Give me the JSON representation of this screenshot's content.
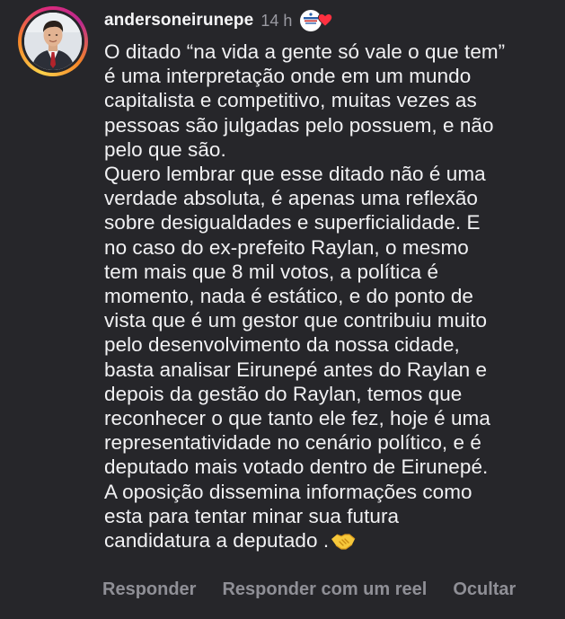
{
  "comment": {
    "username": "andersoneirunepe",
    "timestamp": "14 h",
    "text_lines": [
      "O ditado “na vida a gente só vale o que tem”",
      "é uma interpretação onde em um mundo",
      "capitalista e competitivo, muitas vezes as",
      "pessoas são julgadas pelo possuem, e não",
      "pelo que são.",
      "Quero lembrar que esse ditado não é uma",
      "verdade absoluta, é apenas uma reflexão",
      "sobre desigualdades e superficialidade. E",
      "no caso do ex-prefeito Raylan, o mesmo",
      "tem mais que 8 mil votos, a política é",
      "momento, nada é estático, e do ponto de",
      "vista que é um gestor que contribuiu muito",
      "pelo desenvolvimento da nossa cidade,",
      "basta analisar Eirunepé antes do Raylan e",
      "depois da gestão do Raylan, temos que",
      "reconhecer o que tanto ele fez, hoje é uma",
      "representatividade no cenário político, e é",
      "deputado mais votado dentro de Eirunepé.",
      "A oposição dissemina informações como",
      "esta para tentar minar sua futura",
      "candidatura a deputado ."
    ],
    "trailing_emoji": "handshake-emoji",
    "liked_by_creator": true
  },
  "actions": {
    "reply_label": "Responder",
    "reply_reel_label": "Responder com um reel",
    "hide_label": "Ocultar"
  },
  "colors": {
    "background": "#26262a",
    "text": "#f1f1f3",
    "muted": "#8f8f96",
    "heart": "#ff3040"
  }
}
